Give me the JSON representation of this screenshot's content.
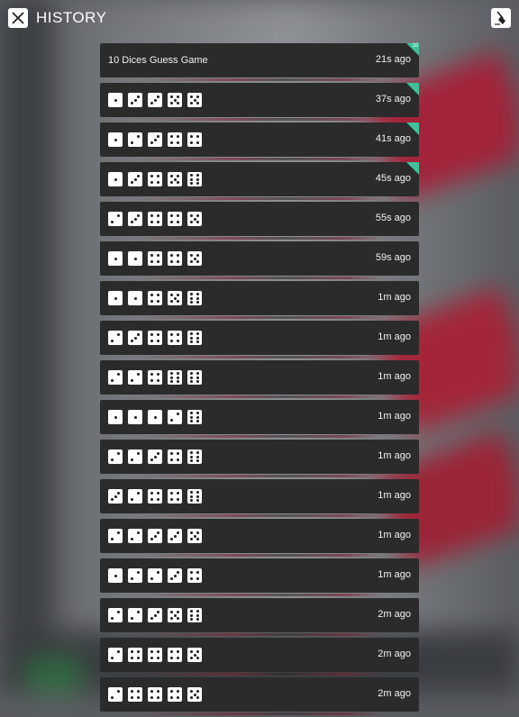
{
  "header": {
    "title": "HISTORY"
  },
  "icons": {
    "close": "close-icon",
    "clear": "clear-history-icon"
  },
  "colors": {
    "row_bg": "#2b2b2b",
    "badge": "#3fbf9a",
    "die": "#ffffff",
    "pip": "#1e1e1e"
  },
  "history": [
    {
      "label": "10 Dices Guess Game",
      "time": "21s ago",
      "badge": "10",
      "dice": []
    },
    {
      "time": "37s ago",
      "badge": "",
      "dice": [
        1,
        3,
        3,
        5,
        5
      ]
    },
    {
      "time": "41s ago",
      "badge": "",
      "dice": [
        1,
        2,
        3,
        4,
        4
      ]
    },
    {
      "time": "45s ago",
      "badge": "",
      "dice": [
        1,
        3,
        4,
        5,
        6
      ]
    },
    {
      "time": "55s ago",
      "badge": "",
      "dice": [
        2,
        3,
        4,
        4,
        5
      ]
    },
    {
      "time": "59s ago",
      "badge": "",
      "dice": [
        1,
        1,
        4,
        4,
        5
      ]
    },
    {
      "time": "1m ago",
      "badge": "",
      "dice": [
        1,
        1,
        4,
        5,
        6
      ]
    },
    {
      "time": "1m ago",
      "badge": "",
      "dice": [
        2,
        3,
        4,
        4,
        6
      ]
    },
    {
      "time": "1m ago",
      "badge": "",
      "dice": [
        2,
        2,
        4,
        6,
        6
      ]
    },
    {
      "time": "1m ago",
      "badge": "",
      "dice": [
        1,
        1,
        1,
        2,
        6
      ]
    },
    {
      "time": "1m ago",
      "badge": "",
      "dice": [
        2,
        2,
        3,
        4,
        6
      ]
    },
    {
      "time": "1m ago",
      "badge": "",
      "dice": [
        3,
        2,
        4,
        4,
        6
      ]
    },
    {
      "time": "1m ago",
      "badge": "",
      "dice": [
        2,
        2,
        3,
        3,
        5
      ]
    },
    {
      "time": "1m ago",
      "badge": "",
      "dice": [
        1,
        2,
        2,
        3,
        4
      ]
    },
    {
      "time": "2m ago",
      "badge": "",
      "dice": [
        2,
        2,
        3,
        5,
        6
      ]
    },
    {
      "time": "2m ago",
      "badge": "",
      "dice": [
        2,
        4,
        4,
        4,
        5
      ]
    },
    {
      "time": "2m ago",
      "badge": "",
      "dice": [
        2,
        4,
        4,
        4,
        5
      ]
    }
  ]
}
